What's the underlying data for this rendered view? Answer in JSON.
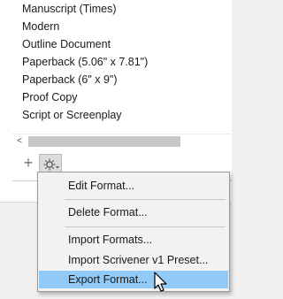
{
  "format_list": {
    "items": [
      "Manuscript (Times)",
      "Modern",
      "Outline Document",
      "Paperback (5.06\" x 7.81\")",
      "Paperback (6\" x 9\")",
      "Proof Copy",
      "Script or Screenplay"
    ]
  },
  "toolbar": {
    "scroll_left_glyph": "<",
    "add_glyph": "+",
    "add_icon": "plus-icon",
    "gear_icon": "gear-icon"
  },
  "context_menu": {
    "items": [
      "Edit Format...",
      "Delete Format...",
      "Import Formats...",
      "Import Scrivener v1 Preset...",
      "Export Format..."
    ],
    "highlighted_index": 4,
    "highlight_color": "#91c9f7"
  }
}
